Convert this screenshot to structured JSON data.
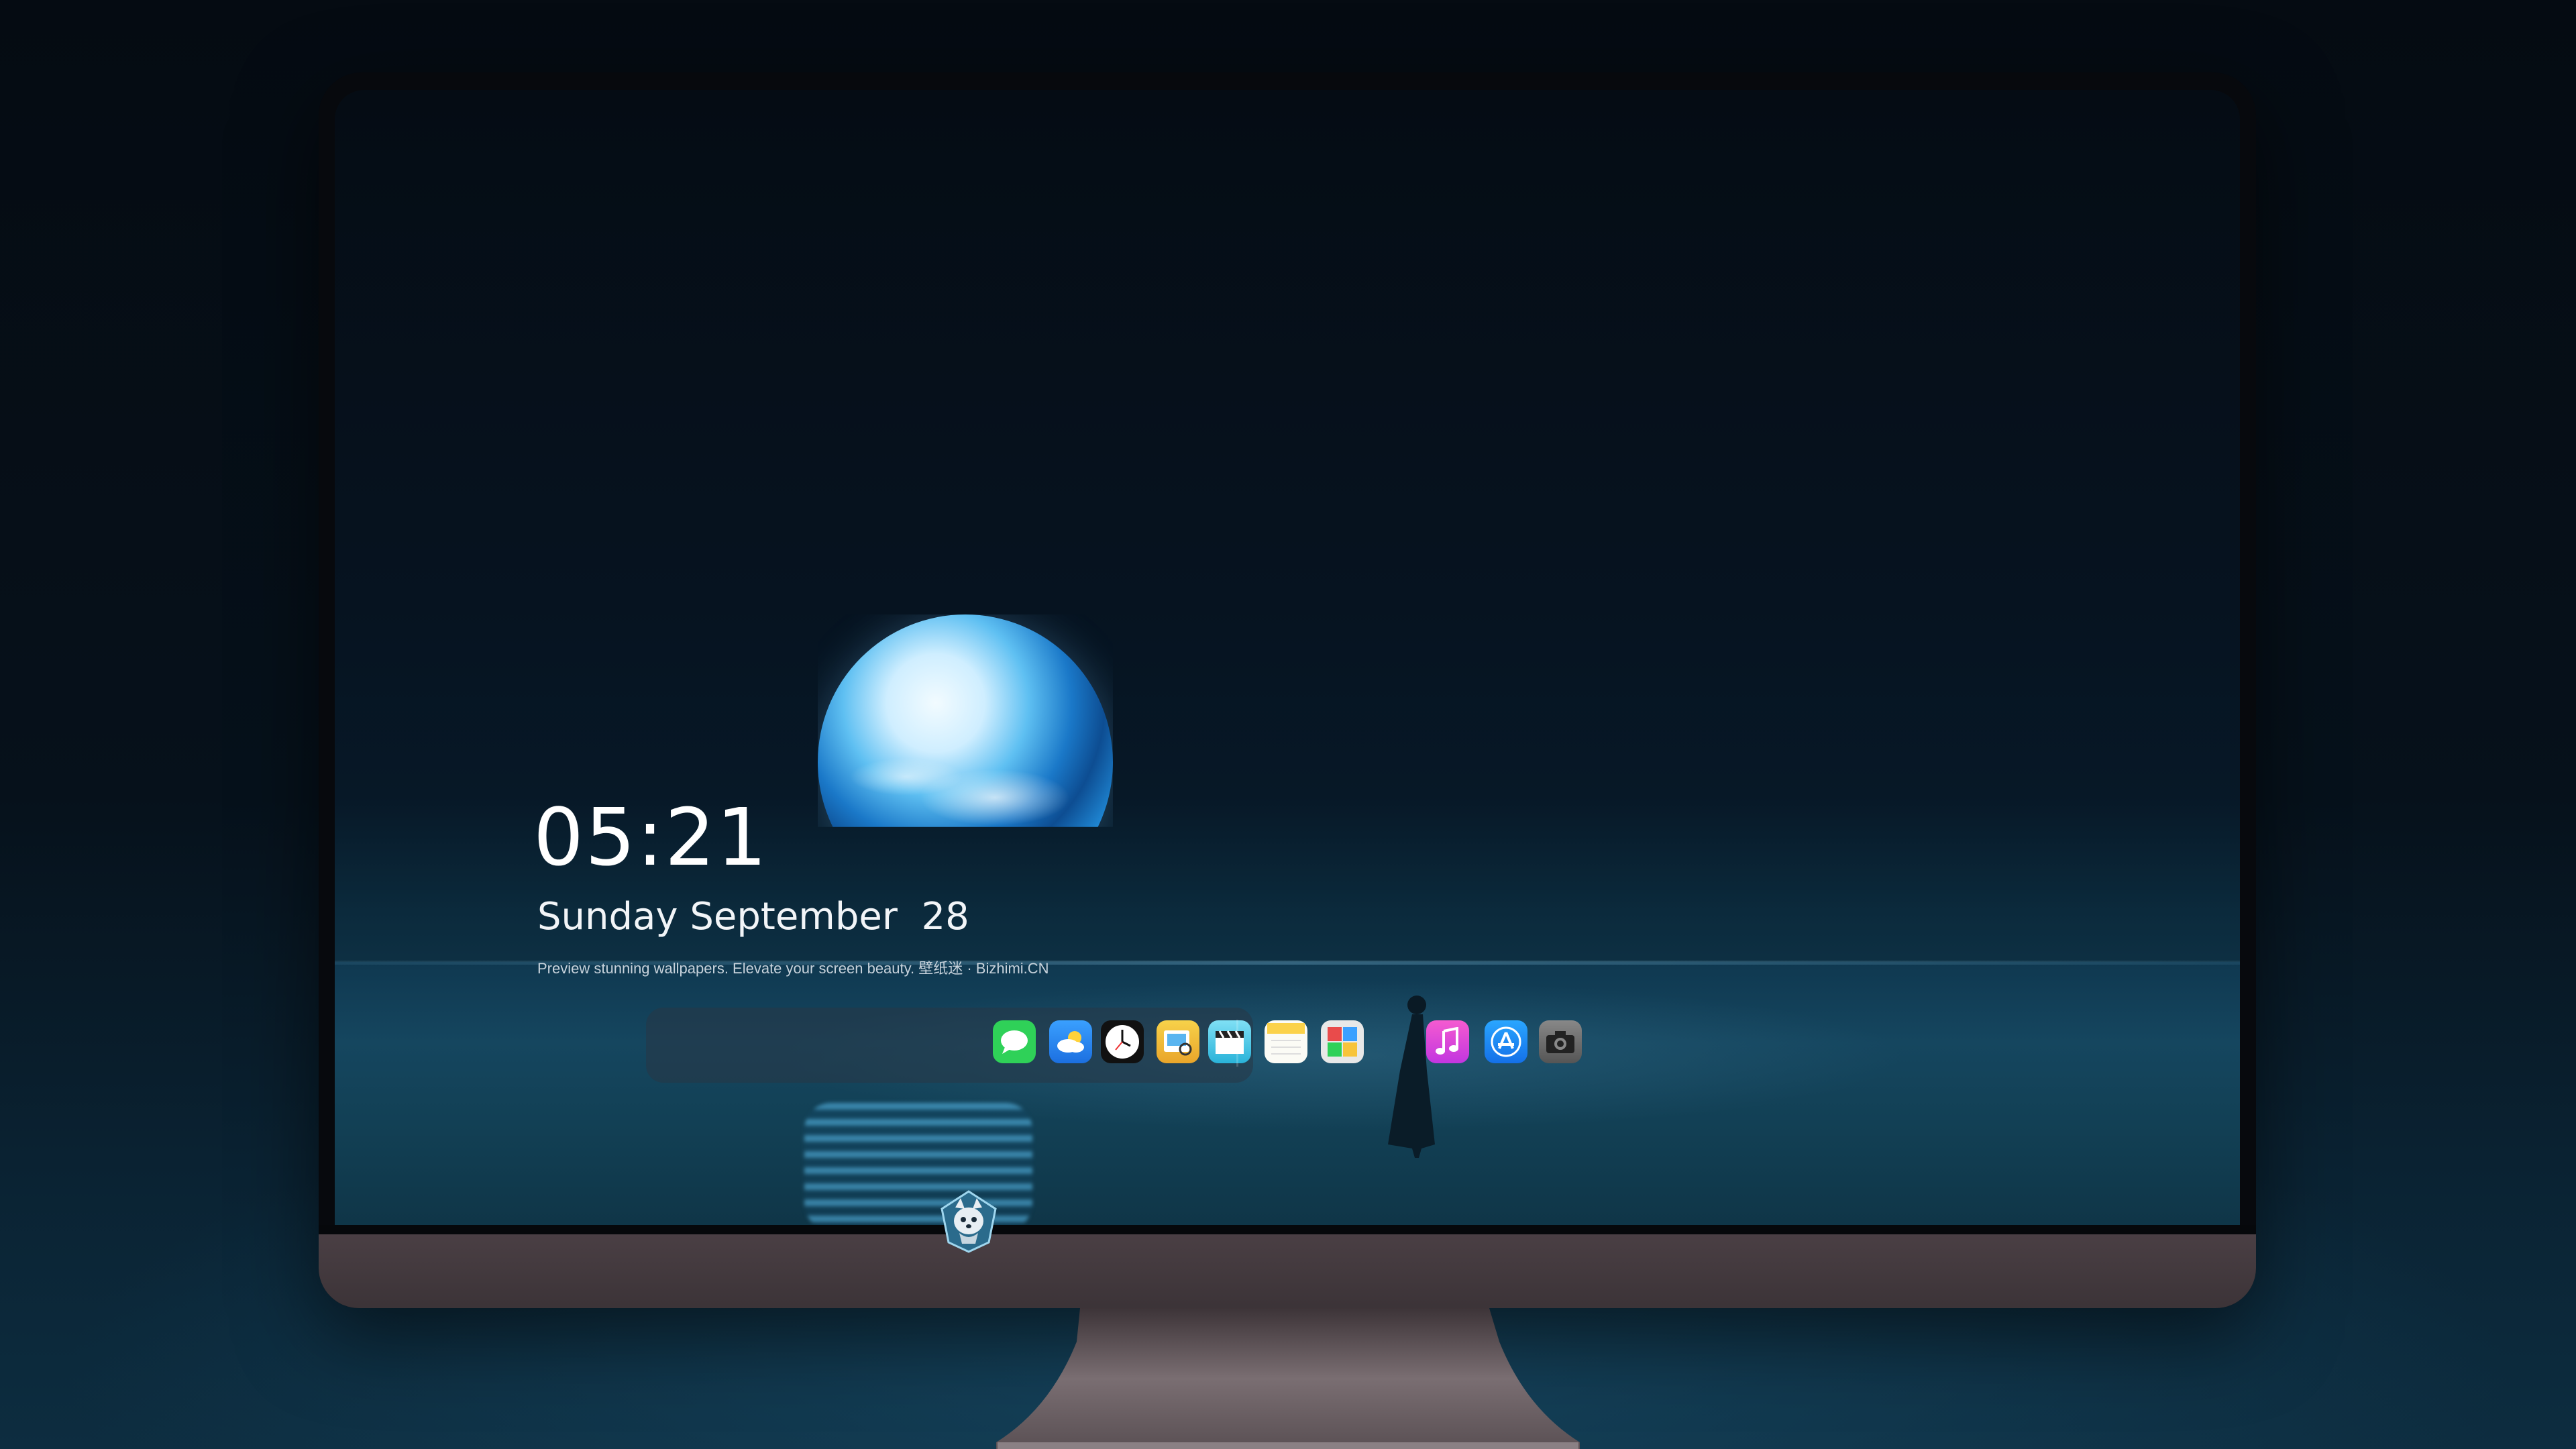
{
  "lock_screen": {
    "time": "05:21",
    "date": "Sunday September  28",
    "caption": "Preview stunning wallpapers. Elevate your screen beauty. 壁纸迷 · Bizhimi.CN"
  },
  "dock": {
    "items": [
      {
        "name": "messages",
        "icon": "chat-bubble-icon",
        "color": "#2fd158"
      },
      {
        "name": "weather",
        "icon": "cloud-sun-icon",
        "color": "#2a86f0"
      },
      {
        "name": "clock",
        "icon": "clock-icon",
        "color": "#111111"
      },
      {
        "name": "preview",
        "icon": "preview-icon",
        "color": "#f4c23a"
      },
      {
        "name": "clips",
        "icon": "clapperboard-icon",
        "color": "#4fc6e8"
      },
      {
        "name": "notes",
        "icon": "notes-icon",
        "color": "#fbd24a"
      },
      {
        "name": "photo-booth",
        "icon": "photo-grid-icon",
        "color": "#e8e8e8"
      },
      {
        "name": "music",
        "icon": "music-note-icon",
        "color": "#e84ac4"
      },
      {
        "name": "app-store",
        "icon": "app-store-icon",
        "color": "#1b8cf5"
      },
      {
        "name": "camera",
        "icon": "camera-icon",
        "color": "#6a6a6a"
      }
    ]
  },
  "monitor": {
    "logo_icon": "husky-mascot-logo-icon",
    "bezel_color": "#07090d",
    "chin_color": "#4a3f44"
  }
}
